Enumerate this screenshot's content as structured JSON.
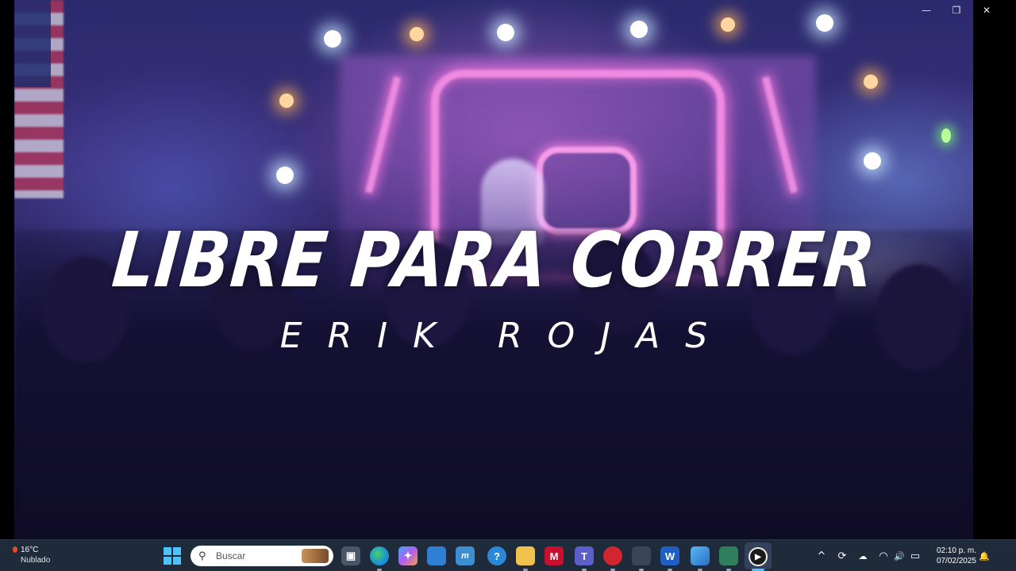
{
  "video": {
    "title_line": "LIBRE PARA CORRER",
    "artist_line": "ERIK ROJAS"
  },
  "window_controls": {
    "minimize": "—",
    "restore": "❐",
    "close": "✕"
  },
  "taskbar": {
    "weather": {
      "temperature": "16°C",
      "condition": "Nublado"
    },
    "search": {
      "placeholder": "Buscar"
    },
    "clock": {
      "time": "02:10 p. m.",
      "date": "07/02/2025"
    },
    "tray_glyphs": {
      "chevron": "^",
      "sync": "⟳",
      "network": "◠",
      "volume": "🔊",
      "battery": "▭",
      "bell": "🔔"
    },
    "icon_glyphs": {
      "task_view": "▣",
      "copilot": "✦",
      "mindmap": "m",
      "help": "?",
      "mcafee": "M",
      "teams": "T",
      "word": "W",
      "media_player": "▶"
    },
    "colors": {
      "accent": "#4cc2ff",
      "edge": "#1b8fd6",
      "store": "#2f7fd4",
      "folder": "#f1c24b",
      "mcafee": "#c8102e",
      "teams": "#5b5fc7",
      "word": "#1f5fc4",
      "red_app": "#d1262f"
    }
  }
}
